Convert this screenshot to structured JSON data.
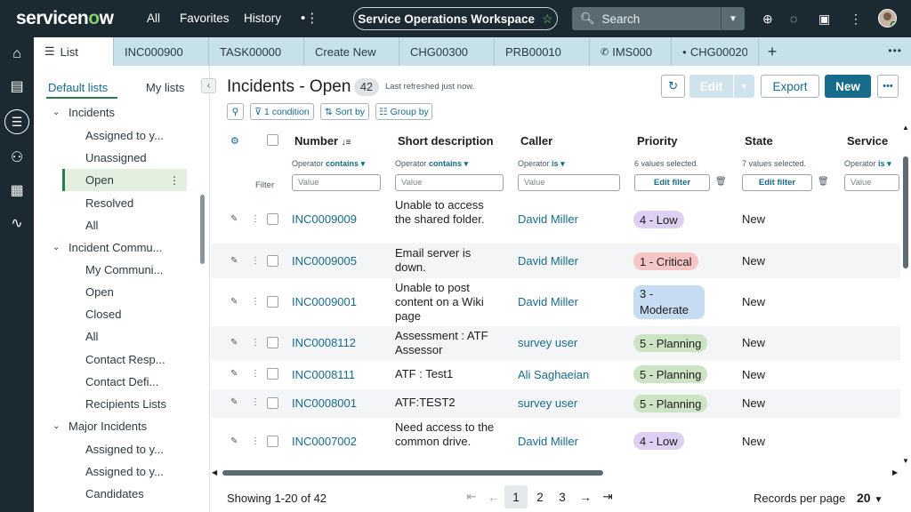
{
  "header": {
    "logo_text": "servicenow",
    "nav": [
      "All",
      "Favorites",
      "History"
    ],
    "workspace": "Service Operations Workspace",
    "search_placeholder": "Search"
  },
  "tabs": [
    {
      "label": "List",
      "icon": "list-icon"
    },
    {
      "label": "INC000900"
    },
    {
      "label": "TASK00000"
    },
    {
      "label": "Create New"
    },
    {
      "label": "CHG00300"
    },
    {
      "label": "PRB00010"
    },
    {
      "label": "IMS000",
      "icon": "phone-icon"
    },
    {
      "label": "CHG00020",
      "icon": "dot-icon"
    }
  ],
  "sidepanel": {
    "tab_default": "Default lists",
    "tab_my": "My lists",
    "items": [
      {
        "label": "Incidents",
        "type": "group"
      },
      {
        "label": "Assigned to y...",
        "type": "child"
      },
      {
        "label": "Unassigned",
        "type": "child"
      },
      {
        "label": "Open",
        "type": "child",
        "selected": true
      },
      {
        "label": "Resolved",
        "type": "child"
      },
      {
        "label": "All",
        "type": "child"
      },
      {
        "label": "Incident Commu...",
        "type": "group"
      },
      {
        "label": "My Communi...",
        "type": "child"
      },
      {
        "label": "Open",
        "type": "child"
      },
      {
        "label": "Closed",
        "type": "child"
      },
      {
        "label": "All",
        "type": "child"
      },
      {
        "label": "Contact Resp...",
        "type": "child"
      },
      {
        "label": "Contact Defi...",
        "type": "child"
      },
      {
        "label": "Recipients Lists",
        "type": "child"
      },
      {
        "label": "Major Incidents",
        "type": "group"
      },
      {
        "label": "Assigned to y...",
        "type": "child"
      },
      {
        "label": "Assigned to y...",
        "type": "child"
      },
      {
        "label": "Candidates",
        "type": "child"
      }
    ]
  },
  "list": {
    "title": "Incidents - Open",
    "count": "42",
    "refreshed": "Last refreshed just now.",
    "buttons": {
      "edit": "Edit",
      "export": "Export",
      "new": "New"
    },
    "filters": {
      "condition": "1 condition",
      "sort": "Sort by",
      "group": "Group by"
    },
    "filter_label": "Filter",
    "columns": [
      "Number",
      "Short description",
      "Caller",
      "Priority",
      "State",
      "Service"
    ],
    "subheaders": {
      "operator": "Operator",
      "contains": "contains",
      "is": "is",
      "priority_sel": "6 values selected.",
      "state_sel": "7 values selected.",
      "value_placeholder": "Value",
      "edit_filter": "Edit filter"
    },
    "rows": [
      {
        "number": "INC0009009",
        "desc": "Unable to access the shared folder.",
        "caller": "David Miller",
        "priority": "4 - Low",
        "state": "New"
      },
      {
        "number": "INC0009005",
        "desc": "Email server is down.",
        "caller": "David Miller",
        "priority": "1 - Critical",
        "state": "New"
      },
      {
        "number": "INC0009001",
        "desc": "Unable to post content on a Wiki page",
        "caller": "David Miller",
        "priority": "3 - Moderate",
        "state": "New"
      },
      {
        "number": "INC0008112",
        "desc": "Assessment : ATF Assessor",
        "caller": "survey user",
        "priority": "5 - Planning",
        "state": "New"
      },
      {
        "number": "INC0008111",
        "desc": "ATF : Test1",
        "caller": "Ali Saghaeian",
        "priority": "5 - Planning",
        "state": "New"
      },
      {
        "number": "INC0008001",
        "desc": "ATF:TEST2",
        "caller": "survey user",
        "priority": "5 - Planning",
        "state": "New"
      },
      {
        "number": "INC0007002",
        "desc": "Need access to the common drive.",
        "caller": "David Miller",
        "priority": "4 - Low",
        "state": "New"
      }
    ]
  },
  "footer": {
    "showing": "Showing 1-20 of 42",
    "pages": [
      "1",
      "2",
      "3"
    ],
    "records_per_page_label": "Records per page",
    "records_per_page": "20"
  },
  "colors": {
    "header_bg": "#1b2a32",
    "accent": "#176b8b",
    "brand_green": "#7fd16a",
    "priority_low": "#ddd0f2",
    "priority_critical": "#f6c6c6",
    "priority_moderate": "#c5dcf2",
    "priority_planning": "#cde4c4"
  }
}
